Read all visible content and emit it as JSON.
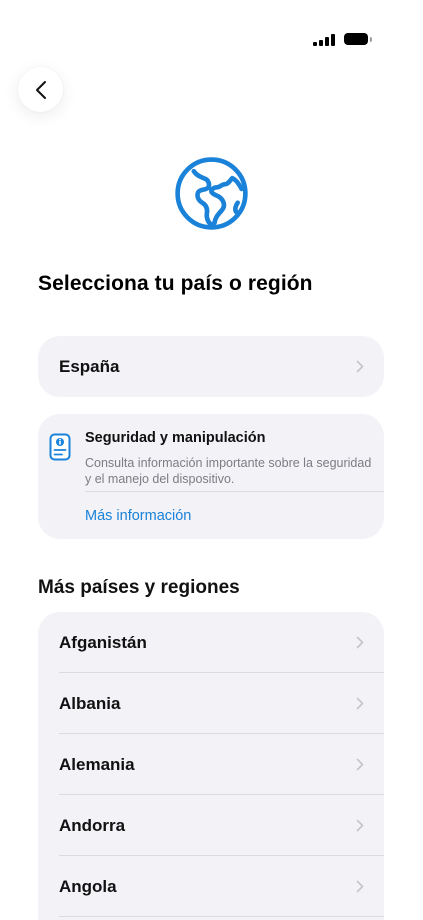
{
  "status_bar": {
    "signal_icon": "cellular-signal-icon",
    "battery_icon": "battery-icon"
  },
  "nav": {
    "back_icon": "chevron-left-icon"
  },
  "header": {
    "icon": "globe-icon",
    "icon_color": "#1a82d8",
    "title": "Selecciona tu país o región"
  },
  "current_country": {
    "label": "España"
  },
  "info_card": {
    "icon": "document-info-icon",
    "title": "Seguridad y manipulación",
    "body": "Consulta información importante sobre la seguridad y el manejo del dispositivo.",
    "link_label": "Más información",
    "link_color": "#1a82d8"
  },
  "more_countries": {
    "title": "Más países y regiones",
    "items": [
      {
        "label": "Afganistán"
      },
      {
        "label": "Albania"
      },
      {
        "label": "Alemania"
      },
      {
        "label": "Andorra"
      },
      {
        "label": "Angola"
      }
    ]
  },
  "colors": {
    "card_background": "#f2f2f7",
    "accent": "#1a82d8"
  }
}
